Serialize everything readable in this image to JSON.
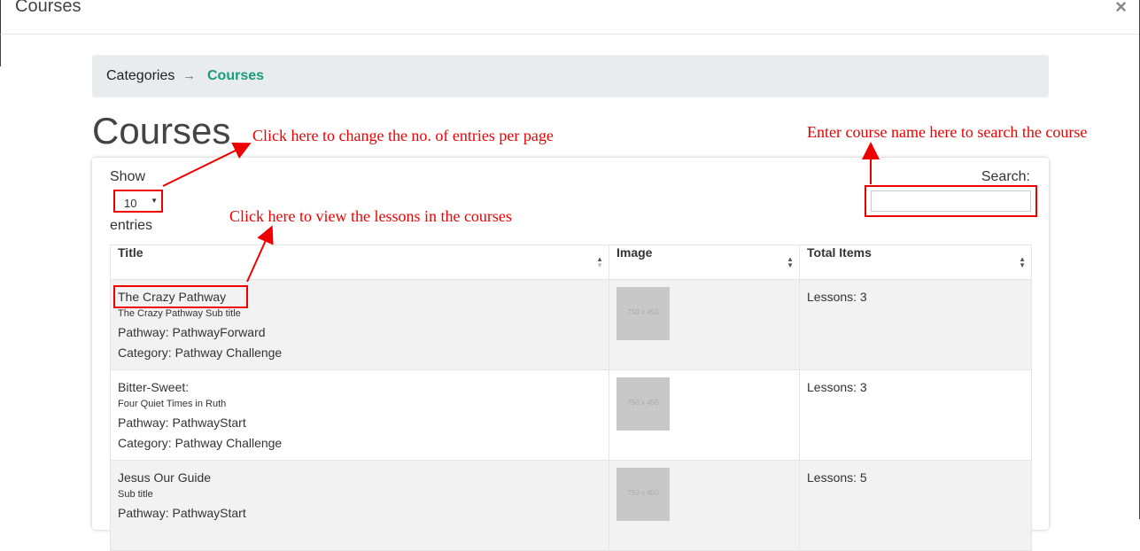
{
  "modal": {
    "title": "Courses",
    "close_label": "×"
  },
  "breadcrumb": {
    "items": [
      "Categories",
      "Courses"
    ],
    "separator": "→"
  },
  "page_title": "Courses",
  "table_controls": {
    "show_label": "Show",
    "entries_label": "entries",
    "page_size": "10",
    "search_label": "Search:",
    "search_value": ""
  },
  "columns": [
    "Title",
    "Image",
    "Total Items"
  ],
  "rows": [
    {
      "title": "The Crazy Pathway",
      "subtitle": "The Crazy Pathway Sub title",
      "pathway": "Pathway: PathwayForward",
      "category": "Category: Pathway Challenge",
      "image_text": "750 x 450",
      "total": "Lessons: 3"
    },
    {
      "title": "Bitter-Sweet:",
      "subtitle": "Four Quiet Times in Ruth",
      "pathway": "Pathway: PathwayStart",
      "category": "Category: Pathway Challenge",
      "image_text": "750 x 450",
      "total": "Lessons: 3"
    },
    {
      "title": "Jesus Our Guide",
      "subtitle": "Sub title",
      "pathway": "Pathway: PathwayStart",
      "category": "",
      "image_text": "750 x 450",
      "total": "Lessons: 5"
    }
  ],
  "annotations": {
    "entries": "Click here to change the no. of entries per page",
    "search": "Enter course name here to search the course",
    "lessons": "Click here to view the lessons in the courses"
  },
  "colors": {
    "accent": "#1a9b79",
    "annotation": "#e00000",
    "breadcrumb_bg": "#e9ecef"
  }
}
